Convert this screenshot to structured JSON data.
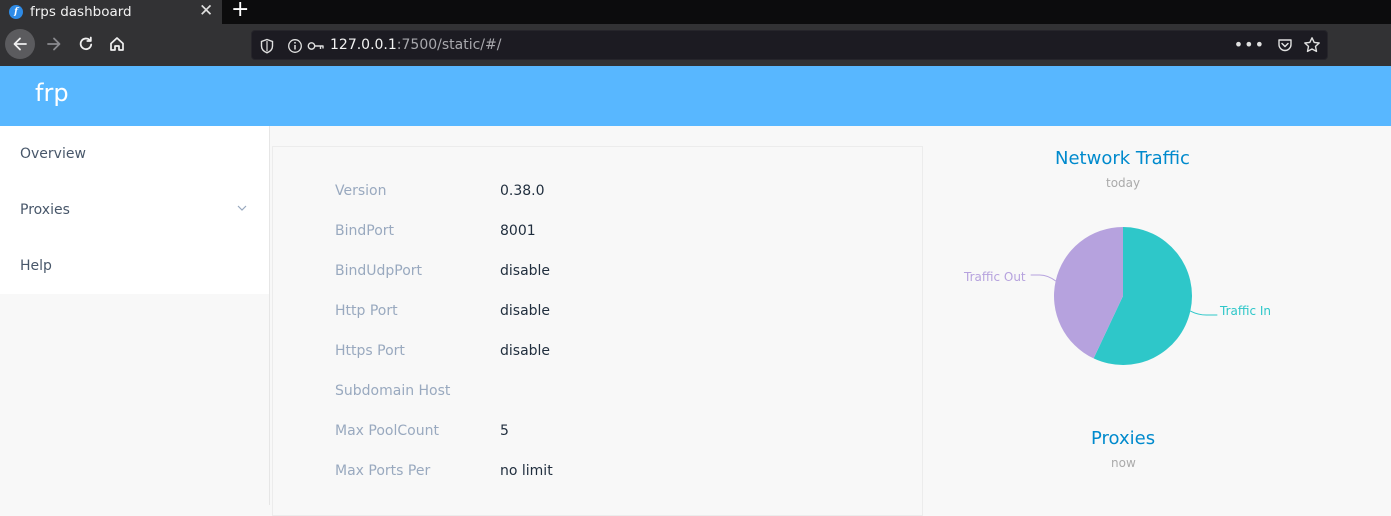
{
  "browser": {
    "tab_title": "frps dashboard",
    "url_host": "127.0.0.1",
    "url_rest": ":7500/static/#/"
  },
  "app": {
    "brand": "frp"
  },
  "sidebar": {
    "items": [
      {
        "label": "Overview"
      },
      {
        "label": "Proxies"
      },
      {
        "label": "Help"
      }
    ]
  },
  "server_info": {
    "rows": [
      {
        "key": "Version",
        "value": "0.38.0"
      },
      {
        "key": "BindPort",
        "value": "8001"
      },
      {
        "key": "BindUdpPort",
        "value": "disable"
      },
      {
        "key": "Http Port",
        "value": "disable"
      },
      {
        "key": "Https Port",
        "value": "disable"
      },
      {
        "key": "Subdomain Host",
        "value": ""
      },
      {
        "key": "Max PoolCount",
        "value": "5"
      },
      {
        "key": "Max Ports Per",
        "value": "no limit"
      }
    ]
  },
  "traffic_chart": {
    "title": "Network Traffic",
    "subtitle": "today",
    "label_in": "Traffic In",
    "label_out": "Traffic Out",
    "color_in": "#2ec7c9",
    "color_out": "#b6a2de"
  },
  "proxies_chart": {
    "title": "Proxies",
    "subtitle": "now"
  },
  "chart_data": {
    "type": "pie",
    "title": "Network Traffic",
    "subtitle": "today",
    "categories": [
      "Traffic In",
      "Traffic Out"
    ],
    "values": [
      57,
      43
    ],
    "colors": [
      "#2ec7c9",
      "#b6a2de"
    ]
  }
}
